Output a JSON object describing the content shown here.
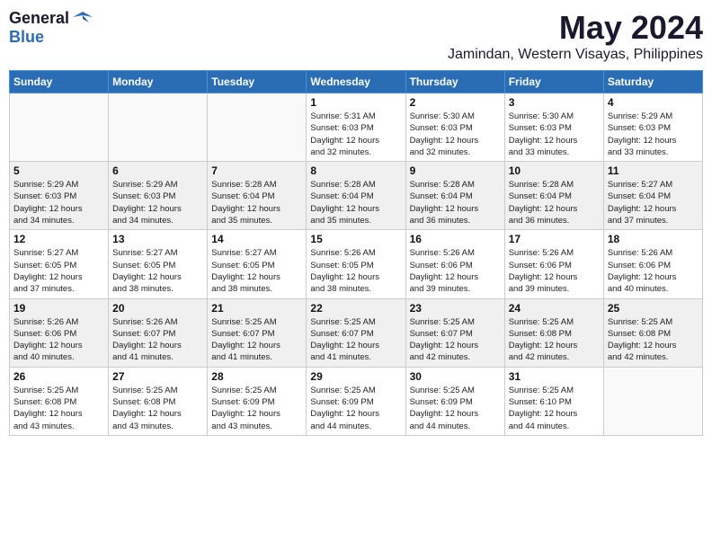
{
  "logo": {
    "general": "General",
    "blue": "Blue"
  },
  "title": {
    "month": "May 2024",
    "location": "Jamindan, Western Visayas, Philippines"
  },
  "days_of_week": [
    "Sunday",
    "Monday",
    "Tuesday",
    "Wednesday",
    "Thursday",
    "Friday",
    "Saturday"
  ],
  "weeks": [
    {
      "row_bg": "light",
      "days": [
        {
          "num": "",
          "info": ""
        },
        {
          "num": "",
          "info": ""
        },
        {
          "num": "",
          "info": ""
        },
        {
          "num": "1",
          "info": "Sunrise: 5:31 AM\nSunset: 6:03 PM\nDaylight: 12 hours\nand 32 minutes."
        },
        {
          "num": "2",
          "info": "Sunrise: 5:30 AM\nSunset: 6:03 PM\nDaylight: 12 hours\nand 32 minutes."
        },
        {
          "num": "3",
          "info": "Sunrise: 5:30 AM\nSunset: 6:03 PM\nDaylight: 12 hours\nand 33 minutes."
        },
        {
          "num": "4",
          "info": "Sunrise: 5:29 AM\nSunset: 6:03 PM\nDaylight: 12 hours\nand 33 minutes."
        }
      ]
    },
    {
      "row_bg": "dark",
      "days": [
        {
          "num": "5",
          "info": "Sunrise: 5:29 AM\nSunset: 6:03 PM\nDaylight: 12 hours\nand 34 minutes."
        },
        {
          "num": "6",
          "info": "Sunrise: 5:29 AM\nSunset: 6:03 PM\nDaylight: 12 hours\nand 34 minutes."
        },
        {
          "num": "7",
          "info": "Sunrise: 5:28 AM\nSunset: 6:04 PM\nDaylight: 12 hours\nand 35 minutes."
        },
        {
          "num": "8",
          "info": "Sunrise: 5:28 AM\nSunset: 6:04 PM\nDaylight: 12 hours\nand 35 minutes."
        },
        {
          "num": "9",
          "info": "Sunrise: 5:28 AM\nSunset: 6:04 PM\nDaylight: 12 hours\nand 36 minutes."
        },
        {
          "num": "10",
          "info": "Sunrise: 5:28 AM\nSunset: 6:04 PM\nDaylight: 12 hours\nand 36 minutes."
        },
        {
          "num": "11",
          "info": "Sunrise: 5:27 AM\nSunset: 6:04 PM\nDaylight: 12 hours\nand 37 minutes."
        }
      ]
    },
    {
      "row_bg": "light",
      "days": [
        {
          "num": "12",
          "info": "Sunrise: 5:27 AM\nSunset: 6:05 PM\nDaylight: 12 hours\nand 37 minutes."
        },
        {
          "num": "13",
          "info": "Sunrise: 5:27 AM\nSunset: 6:05 PM\nDaylight: 12 hours\nand 38 minutes."
        },
        {
          "num": "14",
          "info": "Sunrise: 5:27 AM\nSunset: 6:05 PM\nDaylight: 12 hours\nand 38 minutes."
        },
        {
          "num": "15",
          "info": "Sunrise: 5:26 AM\nSunset: 6:05 PM\nDaylight: 12 hours\nand 38 minutes."
        },
        {
          "num": "16",
          "info": "Sunrise: 5:26 AM\nSunset: 6:06 PM\nDaylight: 12 hours\nand 39 minutes."
        },
        {
          "num": "17",
          "info": "Sunrise: 5:26 AM\nSunset: 6:06 PM\nDaylight: 12 hours\nand 39 minutes."
        },
        {
          "num": "18",
          "info": "Sunrise: 5:26 AM\nSunset: 6:06 PM\nDaylight: 12 hours\nand 40 minutes."
        }
      ]
    },
    {
      "row_bg": "dark",
      "days": [
        {
          "num": "19",
          "info": "Sunrise: 5:26 AM\nSunset: 6:06 PM\nDaylight: 12 hours\nand 40 minutes."
        },
        {
          "num": "20",
          "info": "Sunrise: 5:26 AM\nSunset: 6:07 PM\nDaylight: 12 hours\nand 41 minutes."
        },
        {
          "num": "21",
          "info": "Sunrise: 5:25 AM\nSunset: 6:07 PM\nDaylight: 12 hours\nand 41 minutes."
        },
        {
          "num": "22",
          "info": "Sunrise: 5:25 AM\nSunset: 6:07 PM\nDaylight: 12 hours\nand 41 minutes."
        },
        {
          "num": "23",
          "info": "Sunrise: 5:25 AM\nSunset: 6:07 PM\nDaylight: 12 hours\nand 42 minutes."
        },
        {
          "num": "24",
          "info": "Sunrise: 5:25 AM\nSunset: 6:08 PM\nDaylight: 12 hours\nand 42 minutes."
        },
        {
          "num": "25",
          "info": "Sunrise: 5:25 AM\nSunset: 6:08 PM\nDaylight: 12 hours\nand 42 minutes."
        }
      ]
    },
    {
      "row_bg": "light",
      "days": [
        {
          "num": "26",
          "info": "Sunrise: 5:25 AM\nSunset: 6:08 PM\nDaylight: 12 hours\nand 43 minutes."
        },
        {
          "num": "27",
          "info": "Sunrise: 5:25 AM\nSunset: 6:08 PM\nDaylight: 12 hours\nand 43 minutes."
        },
        {
          "num": "28",
          "info": "Sunrise: 5:25 AM\nSunset: 6:09 PM\nDaylight: 12 hours\nand 43 minutes."
        },
        {
          "num": "29",
          "info": "Sunrise: 5:25 AM\nSunset: 6:09 PM\nDaylight: 12 hours\nand 44 minutes."
        },
        {
          "num": "30",
          "info": "Sunrise: 5:25 AM\nSunset: 6:09 PM\nDaylight: 12 hours\nand 44 minutes."
        },
        {
          "num": "31",
          "info": "Sunrise: 5:25 AM\nSunset: 6:10 PM\nDaylight: 12 hours\nand 44 minutes."
        },
        {
          "num": "",
          "info": ""
        }
      ]
    }
  ]
}
